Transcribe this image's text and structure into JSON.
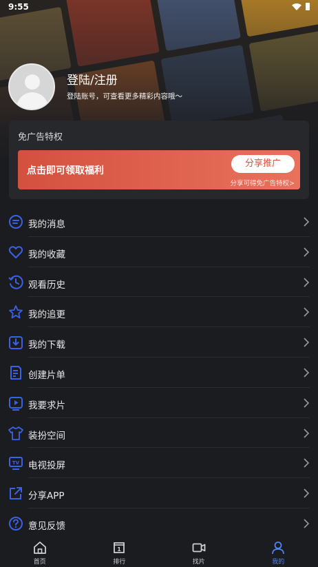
{
  "status_bar": {
    "time": "9:55"
  },
  "profile": {
    "name": "登陆/注册",
    "subtitle": "登陆账号，可查看更多精彩内容哦～"
  },
  "ad_card": {
    "title": "免广告特权",
    "banner_text": "点击即可领取福利",
    "button_label": "分享推广",
    "hint": "分享可得免广告特权>"
  },
  "menu": [
    {
      "label": "我的消息",
      "icon": "message-icon"
    },
    {
      "label": "我的收藏",
      "icon": "heart-icon"
    },
    {
      "label": "观看历史",
      "icon": "history-icon"
    },
    {
      "label": "我的追更",
      "icon": "star-icon"
    },
    {
      "label": "我的下载",
      "icon": "download-icon"
    },
    {
      "label": "创建片单",
      "icon": "playlist-icon"
    },
    {
      "label": "我要求片",
      "icon": "play-request-icon"
    },
    {
      "label": "装扮空间",
      "icon": "shirt-icon"
    },
    {
      "label": "电视投屏",
      "icon": "tv-cast-icon"
    },
    {
      "label": "分享APP",
      "icon": "share-icon"
    },
    {
      "label": "意见反馈",
      "icon": "feedback-icon"
    }
  ],
  "tabs": [
    {
      "label": "首页",
      "icon": "home-icon",
      "active": false
    },
    {
      "label": "排行",
      "icon": "ranking-icon",
      "active": false
    },
    {
      "label": "找片",
      "icon": "video-camera-icon",
      "active": false
    },
    {
      "label": "我的",
      "icon": "user-icon",
      "active": true
    }
  ],
  "colors": {
    "accent": "#4d84f5",
    "icon_blue": "#3b62e6",
    "banner_start": "#d4503f",
    "banner_end": "#e8725c",
    "background": "#1b1c20"
  }
}
